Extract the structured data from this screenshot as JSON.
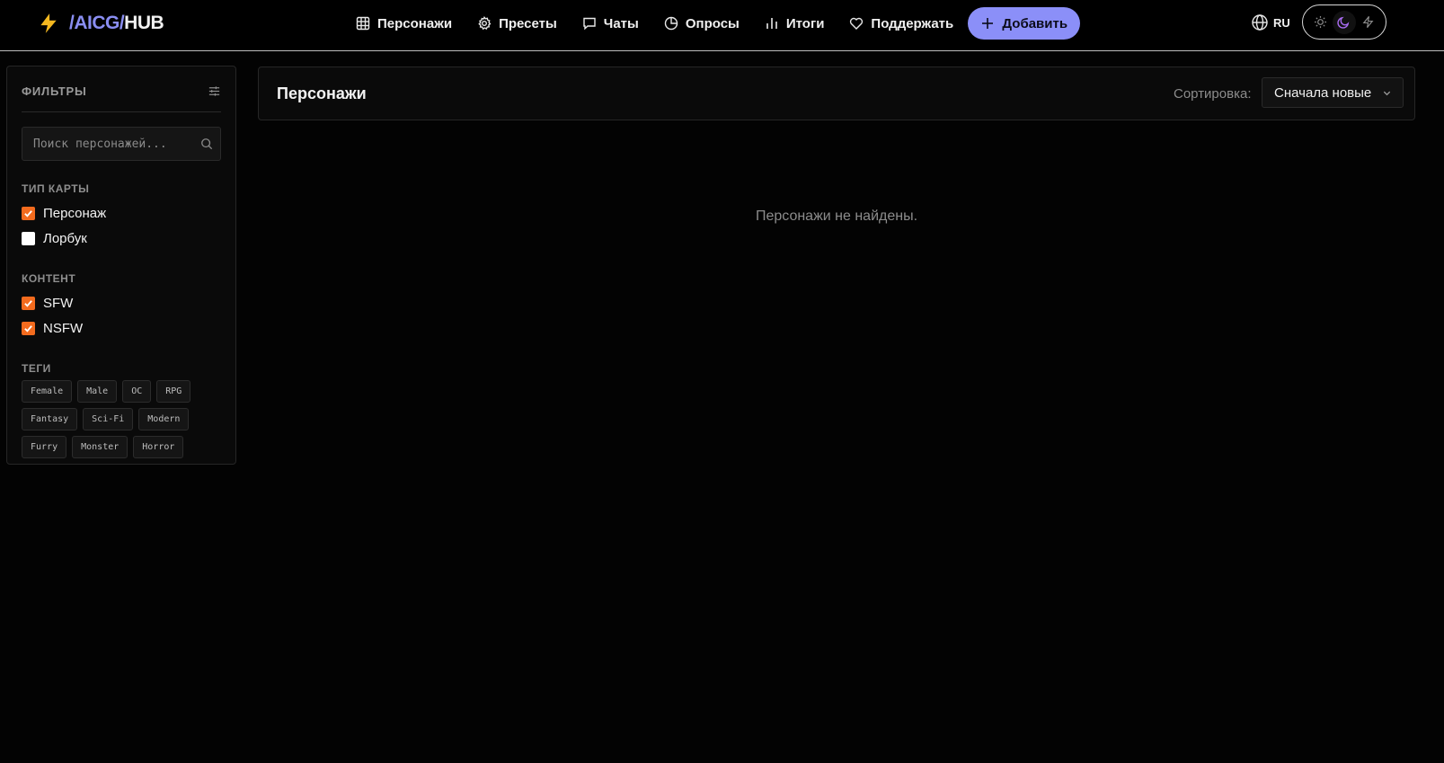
{
  "header": {
    "logo": {
      "prefix": "/AICG/",
      "suffix": "HUB"
    },
    "nav": [
      {
        "label": "Персонажи",
        "icon": "grid-icon"
      },
      {
        "label": "Пресеты",
        "icon": "gear-icon"
      },
      {
        "label": "Чаты",
        "icon": "chat-icon"
      },
      {
        "label": "Опросы",
        "icon": "pie-chart-icon"
      },
      {
        "label": "Итоги",
        "icon": "bar-chart-icon"
      },
      {
        "label": "Поддержать",
        "icon": "heart-icon"
      }
    ],
    "add_label": "Добавить",
    "lang": "RU",
    "theme": {
      "active": "dark",
      "options": [
        "light",
        "dark",
        "lightning"
      ]
    },
    "accent_color": "#8b8ff8"
  },
  "sidebar": {
    "title": "ФИЛЬТРЫ",
    "search_placeholder": "Поиск персонажей...",
    "card_type": {
      "title": "ТИП КАРТЫ",
      "options": [
        {
          "label": "Персонаж",
          "checked": true
        },
        {
          "label": "Лорбук",
          "checked": false
        }
      ]
    },
    "content": {
      "title": "КОНТЕНТ",
      "options": [
        {
          "label": "SFW",
          "checked": true
        },
        {
          "label": "NSFW",
          "checked": true
        }
      ]
    },
    "tags": {
      "title": "ТЕГИ",
      "items": [
        "Female",
        "Male",
        "OC",
        "RPG",
        "Fantasy",
        "Sci-Fi",
        "Modern",
        "Furry",
        "Monster",
        "Horror"
      ]
    },
    "check_color": "#f36b1e"
  },
  "main": {
    "title": "Персонажи",
    "sort_label": "Сортировка:",
    "sort_value": "Сначала новые",
    "empty_text": "Персонажи не найдены."
  }
}
